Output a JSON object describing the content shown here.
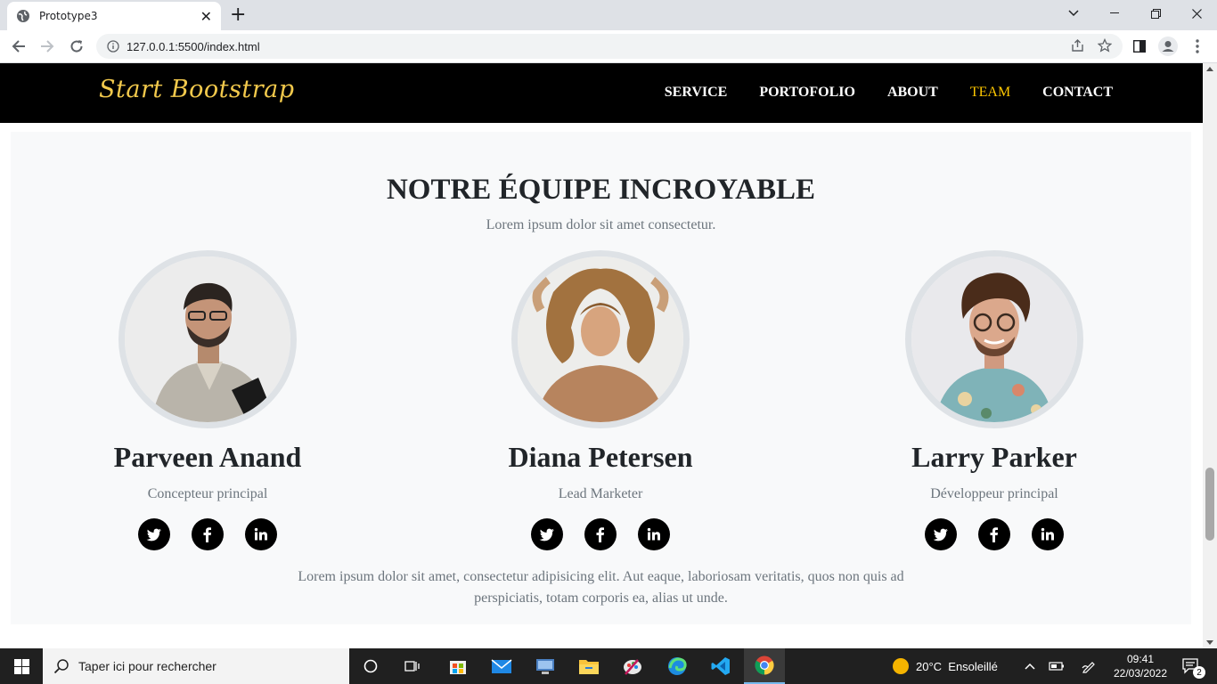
{
  "browser": {
    "tab_title": "Prototype3",
    "url": "127.0.0.1:5500/index.html"
  },
  "site": {
    "brand": "Start Bootstrap",
    "nav": [
      {
        "label": "SERVICE"
      },
      {
        "label": "PORTOFOLIO"
      },
      {
        "label": "ABOUT"
      },
      {
        "label": "TEAM"
      },
      {
        "label": "CONTACT"
      }
    ],
    "accent_color": "#ffc800"
  },
  "team": {
    "heading": "NOTRE ÉQUIPE INCROYABLE",
    "subheading": "Lorem ipsum dolor sit amet consectetur.",
    "members": [
      {
        "name": "Parveen Anand",
        "role": "Concepteur principal"
      },
      {
        "name": "Diana Petersen",
        "role": "Lead Marketer"
      },
      {
        "name": "Larry Parker",
        "role": "Développeur principal"
      }
    ],
    "social_icons": [
      "twitter-icon",
      "facebook-icon",
      "linkedin-icon"
    ],
    "footer_text": "Lorem ipsum dolor sit amet, consectetur adipisicing elit. Aut eaque, laboriosam veritatis, quos non quis ad perspiciatis, totam corporis ea, alias ut unde."
  },
  "taskbar": {
    "search_placeholder": "Taper ici pour rechercher",
    "weather": "20°C  Ensoleillé",
    "time": "09:41",
    "date": "22/03/2022",
    "notifications": "2"
  }
}
